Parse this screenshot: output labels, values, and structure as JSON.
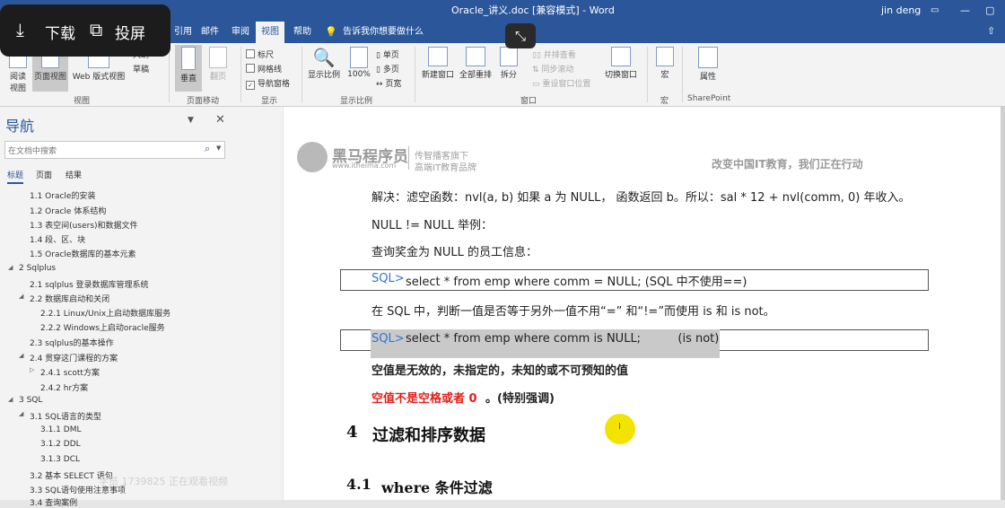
{
  "titlebar": {
    "title": "Oracle_讲义.doc [兼容模式] - Word",
    "user": "jin deng"
  },
  "overlay": {
    "download": "下载",
    "cast": "投屏"
  },
  "tabs": [
    "引用",
    "邮件",
    "审阅",
    "视图",
    "帮助"
  ],
  "active_tab": "视图",
  "tell_me": "告诉我你想要做什么",
  "ribbon": {
    "read_mode": "阅读\n视图",
    "print_layout": "页面视图",
    "web_layout": "Web 版式视图",
    "outline": "大纲",
    "draft": "草稿",
    "vertical": "垂直",
    "side_to_side": "翻页",
    "ruler": "标尺",
    "gridlines": "网格线",
    "nav_pane": "导航窗格",
    "zoom": "显示比例",
    "zoom_100": "100%",
    "one_page": "单页",
    "multi_page": "多页",
    "page_width": "页宽",
    "new_window": "新建窗口",
    "arrange_all": "全部重排",
    "split": "拆分",
    "side_by_side": "并排查看",
    "sync_scroll": "同步滚动",
    "reset_pos": "重设窗口位置",
    "switch_windows": "切换窗口",
    "macros": "宏",
    "properties": "属性",
    "groups": {
      "views": "视图",
      "page_movement": "页面移动",
      "show": "显示",
      "zoom": "显示比例",
      "window": "窗口",
      "macros": "宏",
      "sharepoint": "SharePoint"
    }
  },
  "nav": {
    "title": "导航",
    "search_placeholder": "在文档中搜索",
    "tabs": [
      "标题",
      "页面",
      "结果"
    ],
    "items": [
      "1.1 Oracle的安装",
      "1.2 Oracle 体系结构",
      "1.3 表空间(users)和数据文件",
      "1.4 段、区、块",
      "1.5 Oracle数据库的基本元素",
      "2 Sqlplus",
      "2.1 sqlplus 登录数据库管理系统",
      "2.2 数据库启动和关闭",
      "2.2.1 Linux/Unix上启动数据库服务",
      "2.2.2 Windows上启动oracle服务",
      "2.3 sqlplus的基本操作",
      "2.4 贯穿这门课程的方案",
      "2.4.1 scott方案",
      "2.4.2 hr方案",
      "3 SQL",
      "3.1 SQL语言的类型",
      "3.1.1 DML",
      "3.1.2 DDL",
      "3.1.3 DCL",
      "3.2 基本 SELECT 语句",
      "3.3 SQL语句使用注意事项",
      "3.4 查询案例"
    ],
    "watermark": "学员 1739825 正在观看视频"
  },
  "doc": {
    "brand": "黑马程序员",
    "brand_url": "www.itheima.com",
    "brand_sub1": "传智播客旗下",
    "brand_sub2": "高端IT教育品牌",
    "slogan": "改变中国IT教育，我们正在行动",
    "p1": "解决：滤空函数：nvl(a, b)    如果 a 为 NULL，  函数返回 b。所以：sal * 12 + nvl(comm, 0)  年收入。",
    "p2": "NULL != NULL 举例：",
    "p3": "查询奖金为 NULL 的员工信息：",
    "sql_prompt": "SQL>",
    "sql1": "select * from emp where comm = NULL; (SQL 中不使用==)",
    "p4": "在 SQL 中，判断一值是否等于另外一值不用“=”  和“!=”而使用 is 和 is not。",
    "sql2": "select * from emp where comm is NULL;          (is not)",
    "p5": "空值是无效的，未指定的，未知的或不可预知的值",
    "p6_red": "空值不是空格或者 0",
    "p6_rest": "。(特别强调)",
    "h4_num": "4",
    "h4": "过滤和排序数据",
    "h41_num": "4.1",
    "h41": "where 条件过滤",
    "colors": {
      "red": "#e0201b",
      "blue": "#2e75d6",
      "accent": "#2b579a"
    }
  }
}
